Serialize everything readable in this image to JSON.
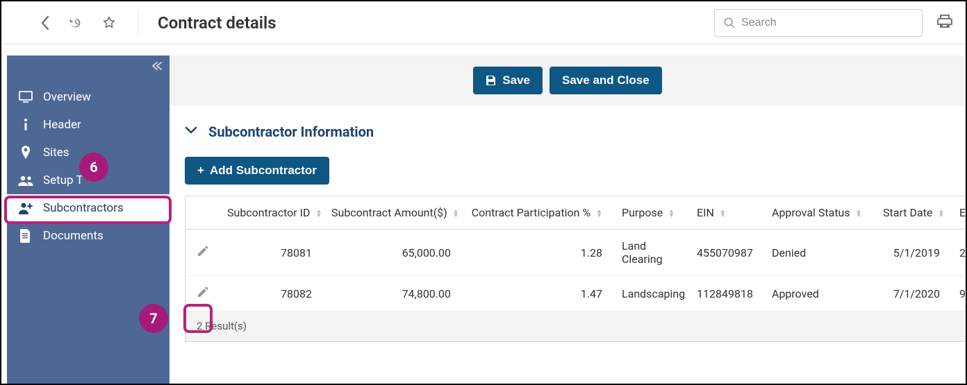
{
  "header": {
    "title": "Contract details",
    "search_placeholder": "Search"
  },
  "sidebar": {
    "items": [
      {
        "label": "Overview",
        "icon": "monitor"
      },
      {
        "label": "Header",
        "icon": "info"
      },
      {
        "label": "Sites",
        "icon": "pin"
      },
      {
        "label": "Setup T",
        "icon": "users"
      },
      {
        "label": "Subcontractors",
        "icon": "user-plus"
      },
      {
        "label": "Documents",
        "icon": "file"
      }
    ]
  },
  "actions": {
    "save": "Save",
    "save_close": "Save and Close"
  },
  "section": {
    "title": "Subcontractor Information",
    "add_button": "Add Subcontractor"
  },
  "table": {
    "columns": [
      "Subcontractor ID",
      "Subcontract Amount($)",
      "Contract Participation %",
      "Purpose",
      "EIN",
      "Approval Status",
      "Start Date",
      "En"
    ],
    "rows": [
      {
        "id": "78081",
        "amount": "65,000.00",
        "participation": "1.28",
        "purpose": "Land Clearing",
        "ein": "455070987",
        "status": "Denied",
        "start": "5/1/2019",
        "end_fragment": "2"
      },
      {
        "id": "78082",
        "amount": "74,800.00",
        "participation": "1.47",
        "purpose": "Landscaping",
        "ein": "112849818",
        "status": "Approved",
        "start": "7/1/2020",
        "end_fragment": "9"
      }
    ],
    "footer": "2 Result(s)"
  },
  "callouts": {
    "six": "6",
    "seven": "7"
  }
}
